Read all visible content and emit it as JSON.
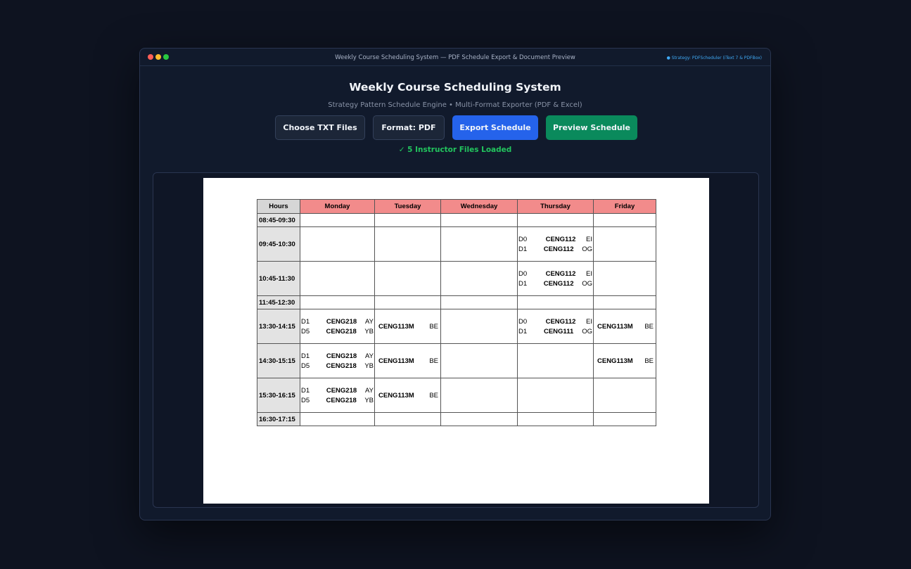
{
  "window": {
    "title": "Weekly Course Scheduling System — PDF Schedule Export & Document Preview",
    "strategy_badge": "● Strategy: PDFScheduler (iText 7 & PDFBox)"
  },
  "header": {
    "title": "Weekly Course Scheduling System",
    "subtitle": "Strategy Pattern Schedule Engine  •  Multi-Format Exporter (PDF & Excel)"
  },
  "toolbar": {
    "choose_label": "Choose TXT Files",
    "format_label": "Format: PDF",
    "export_label": "Export Schedule",
    "preview_label": "Preview Schedule"
  },
  "status": "✓ 5 Instructor Files Loaded",
  "schedule": {
    "headers": [
      "Hours",
      "Monday",
      "Tuesday",
      "Wednesday",
      "Thursday",
      "Friday"
    ],
    "rows": [
      {
        "hour": "08:45-09:30",
        "cells": [
          [],
          [],
          [],
          [],
          []
        ]
      },
      {
        "hour": "09:45-10:30",
        "cells": [
          [],
          [],
          [],
          [
            [
              "D0",
              "CENG112",
              "EI"
            ],
            [
              "D1",
              "CENG112",
              "OG"
            ]
          ],
          []
        ]
      },
      {
        "hour": "10:45-11:30",
        "cells": [
          [],
          [],
          [],
          [
            [
              "D0",
              "CENG112",
              "EI"
            ],
            [
              "D1",
              "CENG112",
              "OG"
            ]
          ],
          []
        ]
      },
      {
        "hour": "11:45-12:30",
        "cells": [
          [],
          [],
          [],
          [],
          []
        ]
      },
      {
        "hour": "13:30-14:15",
        "cells": [
          [
            [
              "D1",
              "CENG218",
              "AY"
            ],
            [
              "D5",
              "CENG218",
              "YB"
            ]
          ],
          [
            [
              "",
              "CENG113M",
              "BE"
            ]
          ],
          [],
          [
            [
              "D0",
              "CENG112",
              "EI"
            ],
            [
              "D1",
              "CENG111",
              "OG"
            ]
          ],
          [
            [
              "",
              "CENG113M",
              "BE"
            ]
          ]
        ]
      },
      {
        "hour": "14:30-15:15",
        "cells": [
          [
            [
              "D1",
              "CENG218",
              "AY"
            ],
            [
              "D5",
              "CENG218",
              "YB"
            ]
          ],
          [
            [
              "",
              "CENG113M",
              "BE"
            ]
          ],
          [],
          [],
          [
            [
              "",
              "CENG113M",
              "BE"
            ]
          ]
        ]
      },
      {
        "hour": "15:30-16:15",
        "cells": [
          [
            [
              "D1",
              "CENG218",
              "AY"
            ],
            [
              "D5",
              "CENG218",
              "YB"
            ]
          ],
          [
            [
              "",
              "CENG113M",
              "BE"
            ]
          ],
          [],
          [],
          []
        ]
      },
      {
        "hour": "16:30-17:15",
        "cells": [
          [],
          [],
          [],
          [],
          []
        ]
      }
    ]
  }
}
